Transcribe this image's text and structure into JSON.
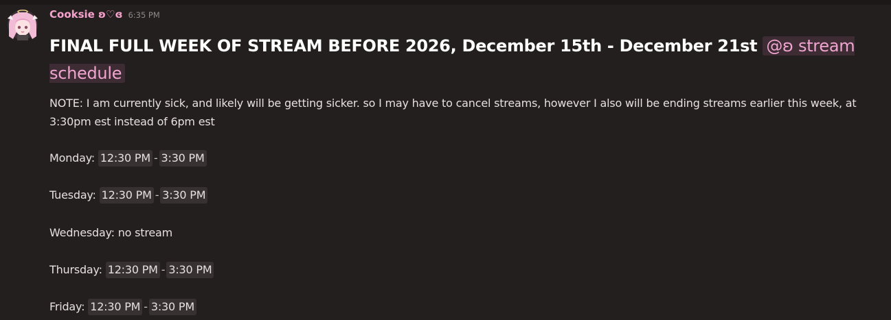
{
  "message": {
    "author": "Cooksie ʚ♡ɞ",
    "timestamp": "6:35 PM",
    "heading": "FINAL FULL WEEK OF STREAM BEFORE 2026, December 15th - December 21st",
    "mention": "@ʚ stream schedule",
    "note": "NOTE: I am currently sick, and likely will be getting sicker. so I may have to cancel streams, however I also will be ending streams earlier this week, at 3:30pm est instead of 6pm est",
    "schedule": [
      {
        "day": "Monday:",
        "start": "12:30 PM",
        "sep": "-",
        "end": "3:30 PM"
      },
      {
        "day": "Tuesday:",
        "start": "12:30 PM",
        "sep": "-",
        "end": "3:30 PM"
      },
      {
        "day": "Wednesday: no stream"
      },
      {
        "day": "Thursday:",
        "start": "12:30 PM",
        "sep": "-",
        "end": "3:30 PM"
      },
      {
        "day": "Friday:",
        "start": "12:30 PM",
        "sep": "-",
        "end": "3:30 PM"
      }
    ]
  },
  "colors": {
    "background": "#231f1e",
    "username": "#f4a3cc",
    "mention_text": "#f0a5d0",
    "mention_bg": "#3d2c34",
    "time_chip_bg": "#373231"
  },
  "icons": {
    "avatar": "anime-girl-avatar-icon"
  }
}
